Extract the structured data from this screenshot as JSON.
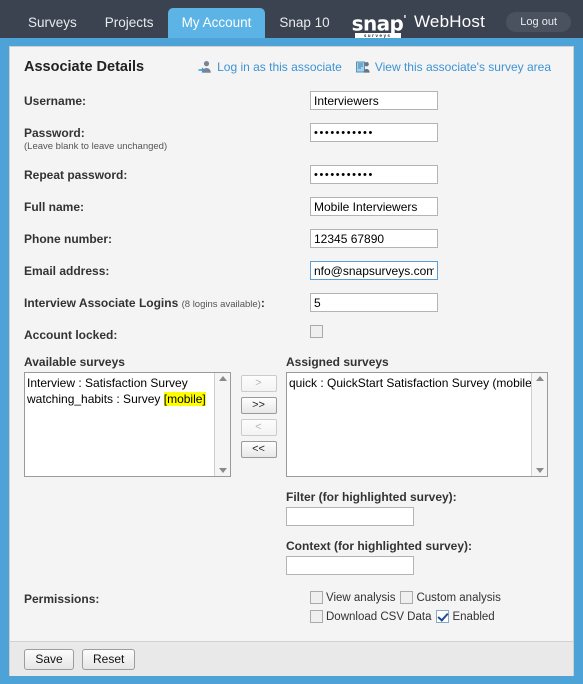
{
  "nav": {
    "tabs": [
      {
        "label": "Surveys",
        "active": false
      },
      {
        "label": "Projects",
        "active": false
      },
      {
        "label": "My Account",
        "active": true
      },
      {
        "label": "Snap 10",
        "active": false
      }
    ],
    "logo_text": "snap",
    "logo_sub": "surveys",
    "product": "WebHost",
    "logout_label": "Log out",
    "active_tab_color": "#5bb4e5",
    "bar_color": "#3b4350"
  },
  "panel": {
    "title": "Associate Details",
    "links": [
      {
        "icon": "login-user-icon",
        "label": "Log in as this associate"
      },
      {
        "icon": "survey-area-icon",
        "label": "View this associate's survey area"
      }
    ],
    "link_color": "#3d93d4"
  },
  "form": {
    "username": {
      "label": "Username:",
      "value": "Interviewers"
    },
    "password": {
      "label": "Password:",
      "hint": "(Leave blank to leave unchanged)",
      "value": "•••••••••••"
    },
    "repeat_password": {
      "label": "Repeat password:",
      "value": "•••••••••••"
    },
    "full_name": {
      "label": "Full name:",
      "value": "Mobile Interviewers"
    },
    "phone": {
      "label": "Phone number:",
      "value": "12345 67890"
    },
    "email": {
      "label": "Email address:",
      "value": "nfo@snapsurveys.com",
      "focused": true
    },
    "logins": {
      "label": "Interview Associate Logins",
      "hint": "(8 logins available)",
      "suffix": ":",
      "value": "5"
    },
    "account_locked": {
      "label": "Account locked:",
      "checked": false
    }
  },
  "surveys": {
    "available_label": "Available surveys",
    "available_items": [
      {
        "text": "Interview : Satisfaction Survey",
        "highlight": ""
      },
      {
        "text": "watching_habits : Survey ",
        "highlight": "[mobile]"
      }
    ],
    "assigned_label": "Assigned surveys",
    "assigned_items": [
      {
        "text": "quick : QuickStart Satisfaction Survey  (mobile)",
        "highlight": ""
      }
    ],
    "buttons": [
      {
        "label": ">",
        "enabled": false
      },
      {
        "label": ">>",
        "enabled": true
      },
      {
        "label": "<",
        "enabled": false
      },
      {
        "label": "<<",
        "enabled": true
      }
    ],
    "highlight_color": "#ffff00"
  },
  "extra_fields": {
    "filter": {
      "label": "Filter (for highlighted survey):",
      "value": ""
    },
    "context": {
      "label": "Context (for highlighted survey):",
      "value": ""
    }
  },
  "permissions": {
    "label": "Permissions:",
    "items": [
      {
        "label": "View analysis",
        "checked": false
      },
      {
        "label": "Custom analysis",
        "checked": false
      },
      {
        "label": "Download CSV Data",
        "checked": false
      },
      {
        "label": "Enabled",
        "checked": true
      }
    ]
  },
  "footer": {
    "save_label": "Save",
    "reset_label": "Reset"
  }
}
